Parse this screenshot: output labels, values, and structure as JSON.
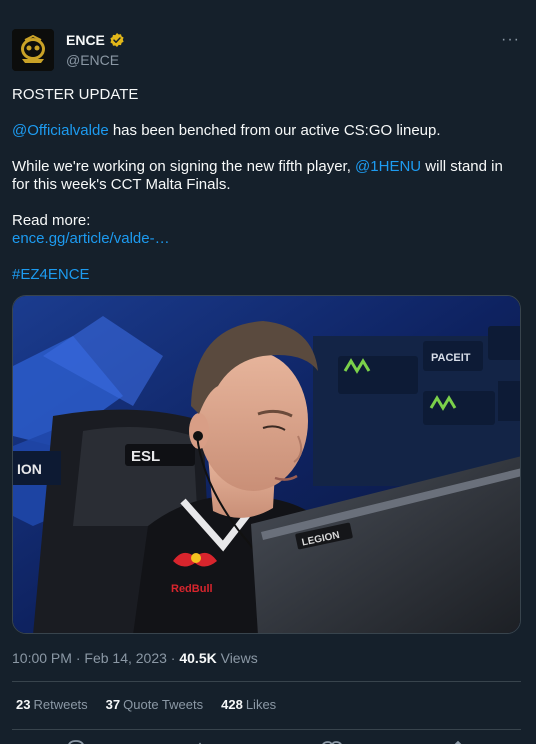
{
  "author": {
    "display_name": "ENCE",
    "handle": "@ENCE",
    "verified": true
  },
  "more_icon": "more-horizontal-icon",
  "tweet": {
    "line1": "ROSTER UPDATE",
    "mention1": "@Officialvalde",
    "line2_rest": " has been benched from our active CS:GO lineup.",
    "line3_pre": "While we're working on signing the new fifth player, ",
    "mention2": "@1HENU",
    "line3_post": " will stand in",
    "line4": "for this week's CCT Malta Finals.",
    "line5": "Read more:",
    "link": "ence.gg/article/valde-…",
    "hashtag": "#EZ4ENCE"
  },
  "meta": {
    "time": "10:00 PM",
    "separator": "·",
    "date": "Feb 14, 2023",
    "views_count": "40.5K",
    "views_label": "Views"
  },
  "stats": {
    "retweets_count": "23",
    "retweets_label": "Retweets",
    "quotes_count": "37",
    "quotes_label": "Quote Tweets",
    "likes_count": "428",
    "likes_label": "Likes"
  },
  "photo_text": {
    "sponsor1": "ESL",
    "sponsor2": "LEGION",
    "jersey": "RedBull",
    "banner1": "ION",
    "banner2": "PACEIT"
  },
  "colors": {
    "background": "#15202b",
    "accent": "#1d9bf0",
    "muted": "#8b98a5",
    "verified_gold": "#e2b719"
  }
}
